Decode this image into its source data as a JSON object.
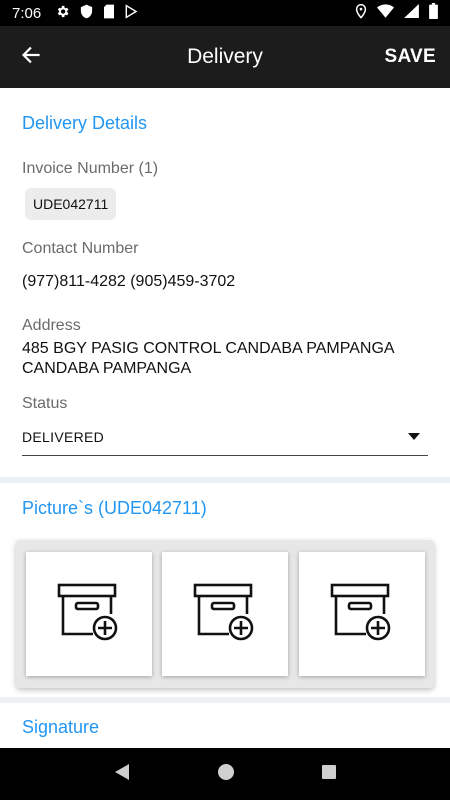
{
  "statusbar": {
    "time": "7:06"
  },
  "appbar": {
    "title": "Delivery",
    "save_label": "SAVE"
  },
  "details": {
    "section_title": "Delivery Details",
    "invoice_label": "Invoice Number (1)",
    "invoice_chip": "UDE042711",
    "contact_label": "Contact Number",
    "contact_value": "(977)811-4282 (905)459-3702",
    "address_label": "Address",
    "address_line1": "485 BGY PASIG CONTROL CANDABA PAMPANGA",
    "address_line2": "CANDABA PAMPANGA",
    "status_label": "Status",
    "status_value": "DELIVERED"
  },
  "pictures": {
    "section_title": "Picture`s (UDE042711)"
  },
  "signature": {
    "section_title": "Signature"
  }
}
